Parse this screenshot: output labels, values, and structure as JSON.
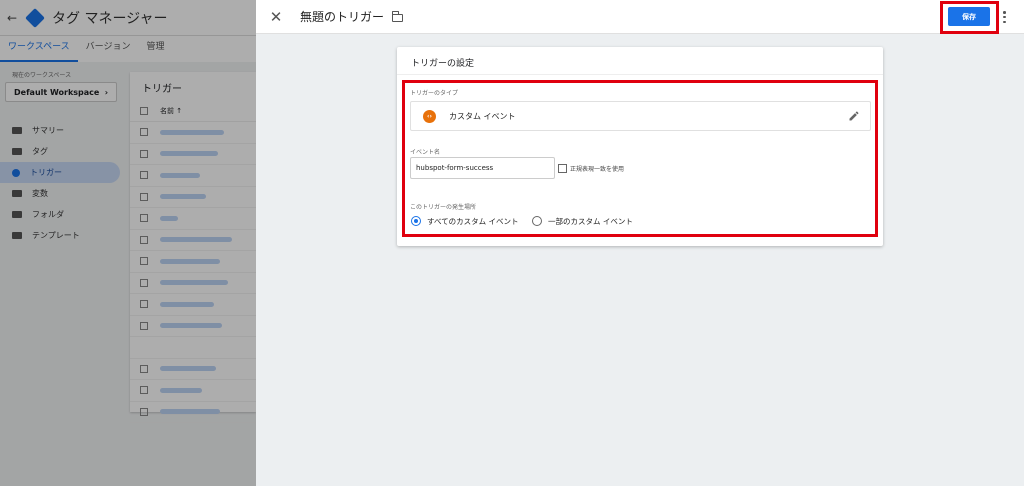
{
  "background_app": {
    "title": "タグ マネージャー",
    "tabs": [
      {
        "label": "ワークスペース",
        "active": true
      },
      {
        "label": "バージョン",
        "active": false
      },
      {
        "label": "管理",
        "active": false
      }
    ],
    "workspace_label": "現在のワークスペース",
    "workspace_name": "Default Workspace",
    "nav_items": [
      {
        "label": "サマリー",
        "icon": "summary-icon",
        "active": false
      },
      {
        "label": "タグ",
        "icon": "tag-icon",
        "active": false
      },
      {
        "label": "トリガー",
        "icon": "trigger-icon",
        "active": true
      },
      {
        "label": "変数",
        "icon": "variable-icon",
        "active": false
      },
      {
        "label": "フォルダ",
        "icon": "folder-icon",
        "active": false
      },
      {
        "label": "テンプレート",
        "icon": "template-icon",
        "active": false
      }
    ],
    "panel_title": "トリガー",
    "column_name": "名前 ↑"
  },
  "sheet": {
    "title": "無題のトリガー",
    "save_label": "保存",
    "card_title": "トリガーの設定",
    "trigger_type_label": "トリガーのタイプ",
    "trigger_type_value": "カスタム イベント",
    "event_name_label": "イベント名",
    "event_name_value": "hubspot-form-success",
    "regex_label": "正規表現一致を使用",
    "fires_on_label": "このトリガーの発生場所",
    "fires_on_options": [
      {
        "label": "すべてのカスタム イベント",
        "selected": true
      },
      {
        "label": "一部のカスタム イベント",
        "selected": false
      }
    ]
  },
  "colors": {
    "accent": "#1a73e8",
    "highlight": "#e0000e",
    "custom_event_icon": "#e8710a"
  }
}
